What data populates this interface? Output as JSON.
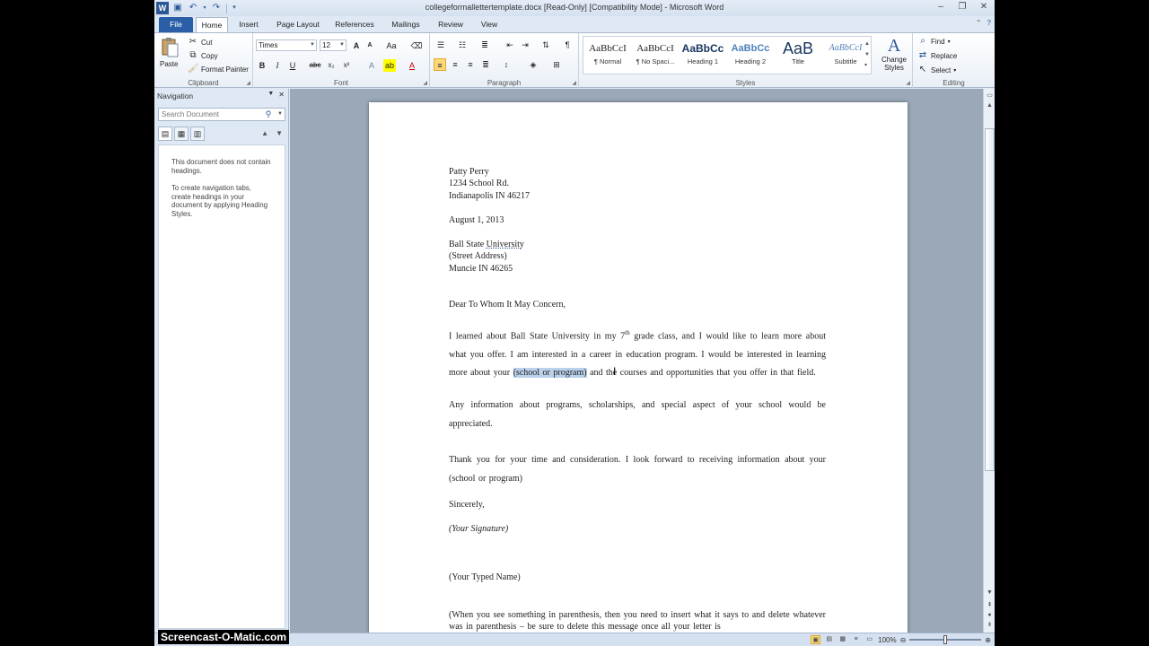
{
  "window": {
    "title": "collegeformallettertemplate.docx [Read-Only] [Compatibility Mode] - Microsoft Word",
    "app_icon": "W"
  },
  "tabs": [
    "File",
    "Home",
    "Insert",
    "Page Layout",
    "References",
    "Mailings",
    "Review",
    "View"
  ],
  "clipboard": {
    "paste": "Paste",
    "cut": "Cut",
    "copy": "Copy",
    "format_painter": "Format Painter",
    "label": "Clipboard"
  },
  "font": {
    "name": "Times",
    "size": "12",
    "label": "Font",
    "bold": "B",
    "italic": "I",
    "underline": "U",
    "strike": "abc",
    "subscript": "x₂",
    "superscript": "x²",
    "grow": "A",
    "shrink": "A",
    "case": "Aa"
  },
  "paragraph": {
    "label": "Paragraph"
  },
  "styles": {
    "label": "Styles",
    "items": [
      {
        "sample": "AaBbCcI",
        "name": "¶ Normal"
      },
      {
        "sample": "AaBbCcI",
        "name": "¶ No Spaci..."
      },
      {
        "sample": "AaBbCc",
        "name": "Heading 1"
      },
      {
        "sample": "AaBbCc",
        "name": "Heading 2"
      },
      {
        "sample": "AaB",
        "name": "Title"
      },
      {
        "sample": "AaBbCcI",
        "name": "Subtitle"
      }
    ],
    "change_styles": "Change Styles"
  },
  "editing": {
    "label": "Editing",
    "find": "Find",
    "replace": "Replace",
    "select": "Select"
  },
  "navigation": {
    "title": "Navigation",
    "search_placeholder": "Search Document",
    "msg1": "This document does not contain headings.",
    "msg2": "To create navigation tabs, create headings in your document by applying Heading Styles."
  },
  "document": {
    "sender_name": "Patty Perry",
    "sender_street": "1234 School Rd.",
    "sender_city": "Indianapolis  IN 46217",
    "date": "August  1, 2013",
    "recipient_name_a": "Ball  State ",
    "recipient_name_b": "University",
    "recipient_street": "(Street Address)",
    "recipient_city": "Muncie  IN 46265",
    "salutation": "Dear To Whom It May Concern,",
    "p1_a": "I learned about Ball  State University  in my 7",
    "p1_sup": "th",
    "p1_b": " grade class, and I would like to learn more about what you offer. I am interested  in a career in education program.   I would be interested  in learning  more about your ",
    "p1_hl": "(school  or program)",
    "p1_c": "  and the courses and opportunities  that you offer  in that field.",
    "p2": "Any information  about programs, scholarships,  and special  aspect of your school would be appreciated.",
    "p3": "Thank  you for your time and consideration.  I look forward to receiving  information  about your (school  or program)",
    "closing": "Sincerely,",
    "signature": "(Your Signature)",
    "typed_name": "(Your Typed Name)",
    "note": "(When you see something  in parenthesis,  then you need to insert  what it says to and delete whatever  was in parenthesis  – be sure to delete  this message  once all your letter is"
  },
  "status": {
    "zoom": "100%"
  },
  "watermark": "Screencast-O-Matic.com"
}
